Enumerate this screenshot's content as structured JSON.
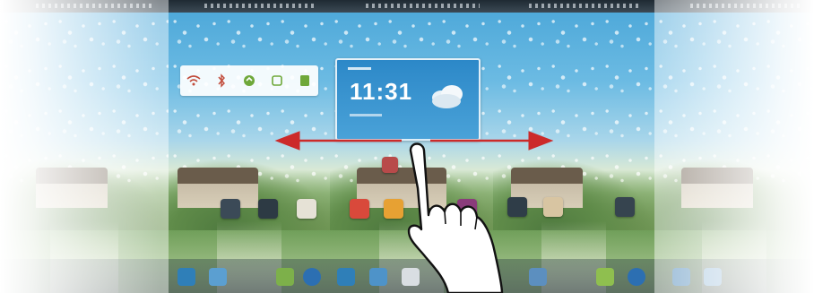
{
  "screen": {
    "description_free": true,
    "panels": [
      "home-screen-1",
      "home-screen-2",
      "home-screen-3",
      "home-screen-4",
      "home-screen-5"
    ]
  },
  "weather_widget": {
    "time": "11:31"
  },
  "quick_toggles": [
    {
      "icon": "wifi-icon"
    },
    {
      "icon": "bluetooth-icon"
    },
    {
      "icon": "data-icon"
    },
    {
      "icon": "rotation-icon"
    },
    {
      "icon": "brightness-icon"
    }
  ],
  "gesture": {
    "type": "swipe-left-right",
    "arrow_color": "#cc2a2a"
  },
  "colors": {
    "accent": "#cc2a2a",
    "widget_blue": "#2c88c8"
  }
}
